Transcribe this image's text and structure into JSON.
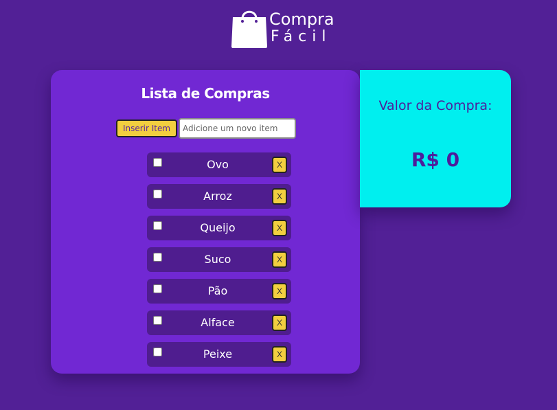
{
  "app": {
    "brand_line1": "Compra",
    "brand_line2": "Fácil",
    "logo_icon": "shopping-bag-icon"
  },
  "list": {
    "title": "Lista de Compras",
    "add_button_label": "Inserir Item",
    "input_placeholder": "Adicione um novo item",
    "input_value": "",
    "remove_label": "X",
    "items": [
      {
        "label": "Ovo",
        "checked": false
      },
      {
        "label": "Arroz",
        "checked": false
      },
      {
        "label": "Queijo",
        "checked": false
      },
      {
        "label": "Suco",
        "checked": false
      },
      {
        "label": "Pão",
        "checked": false
      },
      {
        "label": "Alface",
        "checked": false
      },
      {
        "label": "Peixe",
        "checked": false
      }
    ]
  },
  "total": {
    "title": "Valor da Compra:",
    "value": "R$ 0"
  },
  "colors": {
    "background": "#522096",
    "list_card": "#7128d3",
    "item_row": "#4f1d8f",
    "accent_yellow": "#f2cf3f",
    "total_card": "#00efef",
    "total_text": "#4e1d9b"
  }
}
